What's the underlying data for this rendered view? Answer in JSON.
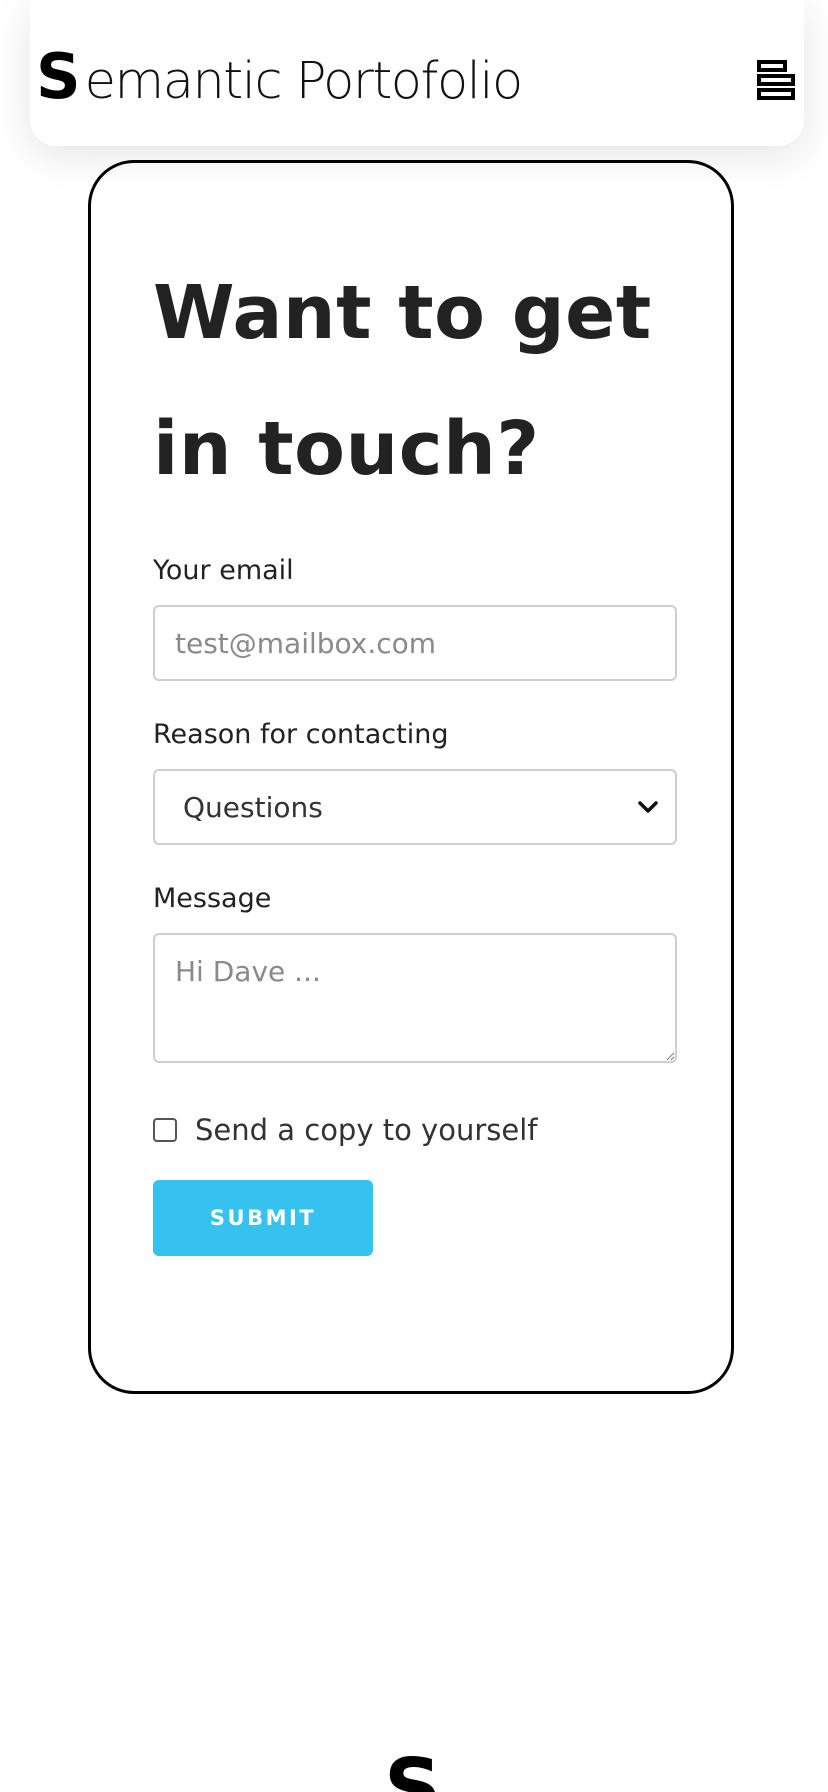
{
  "header": {
    "brand_initial": "S",
    "brand_rest": "emantic Portofolio",
    "menu_icon": "menu-toggle-icon"
  },
  "contact": {
    "title": "Want to get in touch?",
    "email_label": "Your email",
    "email_placeholder": "test@mailbox.com",
    "email_value": "",
    "reason_label": "Reason for contacting",
    "reason_selected": "Questions",
    "message_label": "Message",
    "message_placeholder": "Hi Dave ...",
    "message_value": "",
    "copy_label": "Send a copy to yourself",
    "copy_checked": false,
    "submit_label": "SUBMIT"
  },
  "footer": {
    "logo_initial": "S"
  },
  "colors": {
    "accent": "#35c2ef",
    "text": "#222222",
    "border": "#000000"
  }
}
